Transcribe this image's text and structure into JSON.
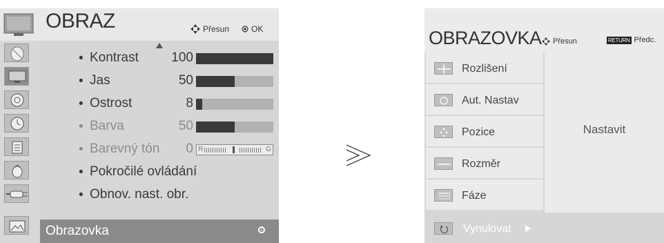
{
  "left_menu": {
    "title": "OBRAZ",
    "hint_move": "Přesun",
    "hint_ok": "OK",
    "items": [
      {
        "label": "Kontrast",
        "value": "100",
        "level": 1.0
      },
      {
        "label": "Jas",
        "value": "50",
        "level": 0.5
      },
      {
        "label": "Ostrost",
        "value": "8",
        "level": 0.08
      },
      {
        "label": "Barva",
        "value": "50",
        "level": 0.5
      },
      {
        "label": "Barevný tón",
        "value": "0",
        "tint_left": "R",
        "tint_right": "G"
      },
      {
        "label": "Pokročilé ovládání"
      },
      {
        "label": "Obnov. nast. obr."
      }
    ],
    "selected_label": "Obrazovka",
    "categories": [
      "tv-icon",
      "satellite-dish-icon",
      "picture-icon",
      "audio-icon",
      "clock-icon",
      "lock-icon",
      "padlock-icon",
      "connector-icon",
      "photo-icon"
    ]
  },
  "transition_symbol": "≫",
  "right_menu": {
    "title": "OBRAZOVKA",
    "hint_move": "Přesun",
    "return_key": "RETURN",
    "hint_back": "Předc.",
    "items": [
      {
        "label": "Rozlišení",
        "icon": "crosshair-icon"
      },
      {
        "label": "Aut. Nastav",
        "icon": "auto-config-icon"
      },
      {
        "label": "Pozice",
        "icon": "position-arrows-icon"
      },
      {
        "label": "Rozměr",
        "icon": "size-icon"
      },
      {
        "label": "Fáze",
        "icon": "phase-icon"
      }
    ],
    "value_label": "Nastavit",
    "reset_label": "Vynulovat"
  }
}
